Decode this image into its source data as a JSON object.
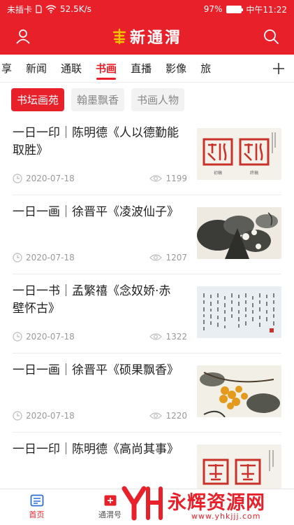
{
  "status_bar": {
    "carrier": "未插卡",
    "speed": "52.5K/s",
    "battery": "97%",
    "battery_level": 0.97,
    "time": "中午11:22"
  },
  "header": {
    "logo_text": "新通渭"
  },
  "tabs": [
    {
      "label": "享"
    },
    {
      "label": "新闻"
    },
    {
      "label": "通联"
    },
    {
      "label": "书画"
    },
    {
      "label": "直播"
    },
    {
      "label": "影像"
    },
    {
      "label": "旅"
    }
  ],
  "active_tab": "书画",
  "sub_tabs": [
    {
      "label": "书坛画苑"
    },
    {
      "label": "翰墨飘香"
    },
    {
      "label": "书画人物"
    }
  ],
  "articles": [
    {
      "title": "一日一印｜陈明德《人以德勤能取胜》",
      "date": "2020-07-18",
      "views": "1199",
      "thumb_labels": [
        "初稿",
        "终稿"
      ]
    },
    {
      "title": "一日一画｜徐晋平《凌波仙子》",
      "date": "2020-07-18",
      "views": "1207"
    },
    {
      "title": "一日一书｜孟繁禧《念奴娇·赤壁怀古》",
      "date": "2020-07-18",
      "views": "1322"
    },
    {
      "title": "一日一画｜徐晋平《硕果飘香》",
      "date": "2020-07-18",
      "views": "1220"
    },
    {
      "title": "一日一印｜陈明德《高尚其事》",
      "date": "",
      "views": ""
    }
  ],
  "bottom_nav": [
    {
      "label": "首页"
    },
    {
      "label": "通渭号"
    }
  ],
  "watermark": {
    "text": "永辉资源网",
    "url": "www.yhkjjj.com"
  },
  "colors": {
    "brand": "#e8202a",
    "muted": "#999999"
  }
}
